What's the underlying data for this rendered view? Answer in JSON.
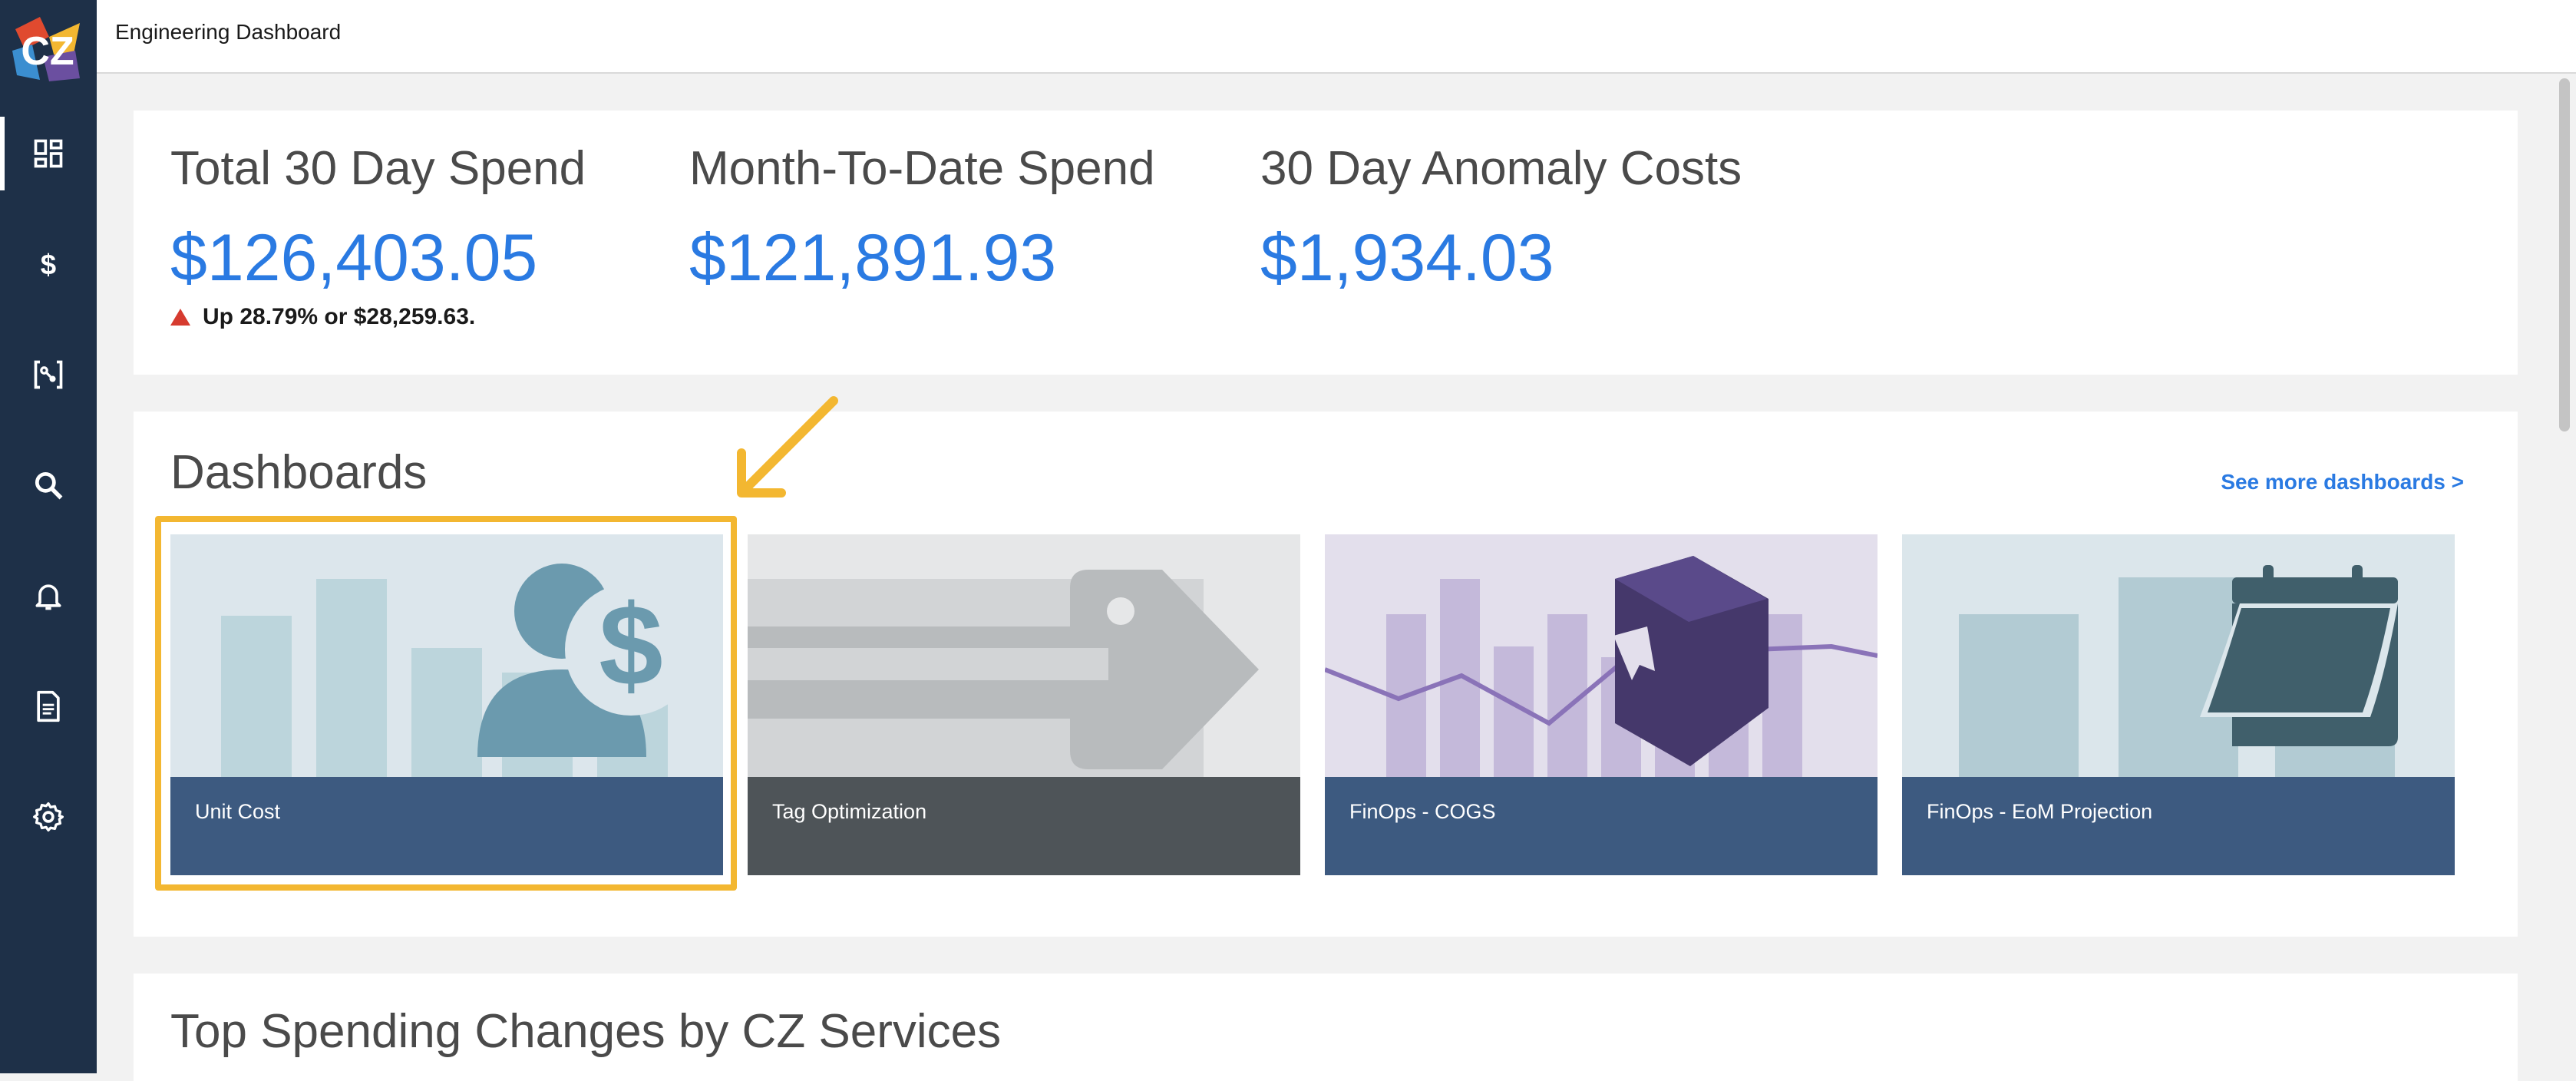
{
  "topbar": {
    "title": "Engineering Dashboard"
  },
  "logo": {
    "text": "CZ"
  },
  "sidebar": {
    "items": [
      {
        "icon": "dashboard-icon",
        "active": true
      },
      {
        "icon": "dollar-icon",
        "active": false
      },
      {
        "icon": "anomaly-icon",
        "active": false
      },
      {
        "icon": "search-icon",
        "active": false
      },
      {
        "icon": "bell-icon",
        "active": false
      },
      {
        "icon": "document-icon",
        "active": false
      },
      {
        "icon": "gear-icon",
        "active": false
      }
    ]
  },
  "stats": {
    "total": {
      "label": "Total 30 Day Spend",
      "value": "$126,403.05",
      "change": "Up 28.79% or $28,259.63."
    },
    "mtd": {
      "label": "Month-To-Date Spend",
      "value": "$121,891.93"
    },
    "anomaly": {
      "label": "30 Day Anomaly Costs",
      "value": "$1,934.03"
    }
  },
  "dashboards": {
    "title": "Dashboards",
    "see_more": "See more dashboards >",
    "tiles": [
      {
        "label": "Unit Cost",
        "footer_color": "#3d5a80",
        "bg_color": "#dce6ec"
      },
      {
        "label": "Tag Optimization",
        "footer_color": "#4e5458",
        "bg_color": "#e6e7e8"
      },
      {
        "label": "FinOps - COGS",
        "footer_color": "#3d5a80",
        "bg_color": "#e3dfec"
      },
      {
        "label": "FinOps - EoM Projection",
        "footer_color": "#3d5a80",
        "bg_color": "#dbe6eb"
      }
    ]
  },
  "top_spending": {
    "title": "Top Spending Changes by CZ Services"
  },
  "colors": {
    "accent": "#2a7ae2",
    "sidebar": "#1e3048",
    "highlight": "#f3b731",
    "alert": "#d63b2f"
  }
}
